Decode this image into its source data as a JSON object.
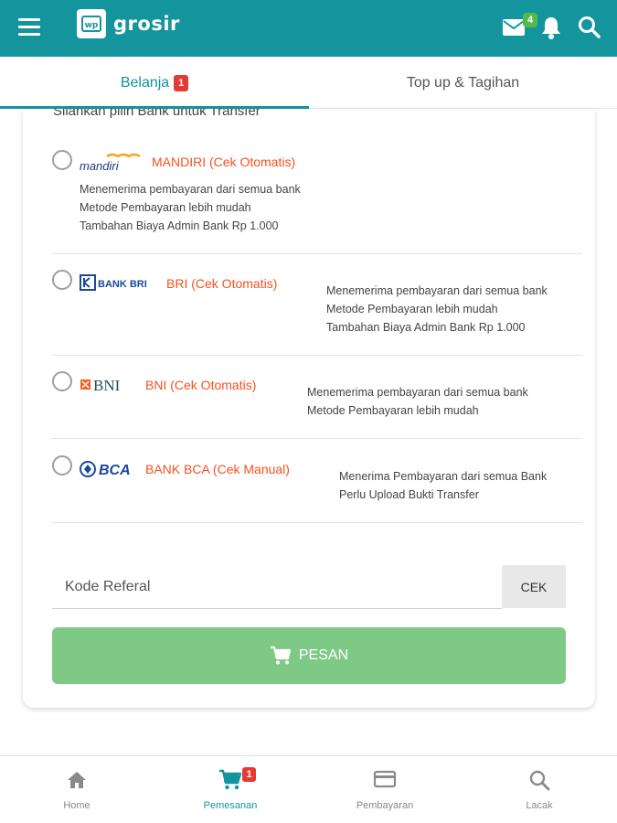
{
  "app": {
    "logo_text": "grosir",
    "logo_mark": "wp",
    "mail_count": "4"
  },
  "tabs": [
    {
      "label": "Belanja",
      "badge": "1",
      "active": true
    },
    {
      "label": "Top up & Tagihan",
      "active": false
    }
  ],
  "payment": {
    "cut_label": "Silahkan pilih Bank untuk Transfer",
    "banks": [
      {
        "logo_text": "mandiri",
        "name": "MANDIRI (Cek Otomatis)",
        "desc": [
          "Menemerima pembayaran dari semua bank",
          "Metode Pembayaran lebih mudah",
          "Tambahan Biaya Admin Bank Rp 1.000"
        ]
      },
      {
        "logo_text": "BANK BRI",
        "name": "BRI (Cek Otomatis)",
        "desc": [
          "Menemerima pembayaran dari semua bank",
          "Metode Pembayaran lebih mudah",
          "Tambahan Biaya Admin Bank Rp 1.000"
        ]
      },
      {
        "logo_text": "BNI",
        "name": "BNI (Cek Otomatis)",
        "desc": [
          "Menemerima pembayaran dari semua bank",
          "Metode Pembayaran lebih mudah"
        ]
      },
      {
        "logo_text": "BCA",
        "name": "BANK BCA (Cek Manual)",
        "desc": [
          "Menerima Pembayaran dari semua Bank",
          "Perlu Upload Bukti Transfer"
        ]
      }
    ]
  },
  "referral": {
    "placeholder": "Kode Referal",
    "button": "CEK"
  },
  "order_button": "PESAN",
  "bottom_nav": [
    {
      "label": "Home",
      "icon": "home-icon"
    },
    {
      "label": "Pemesanan",
      "icon": "cart-icon",
      "badge": "1",
      "active": true
    },
    {
      "label": "Pembayaran",
      "icon": "card-icon"
    },
    {
      "label": "Lacak",
      "icon": "search-icon"
    }
  ],
  "colors": {
    "primary": "#14959d",
    "accent_orange": "#f4511e",
    "order_button": "#7fc986",
    "badge_red": "#e53935",
    "badge_green": "#55b94a"
  }
}
